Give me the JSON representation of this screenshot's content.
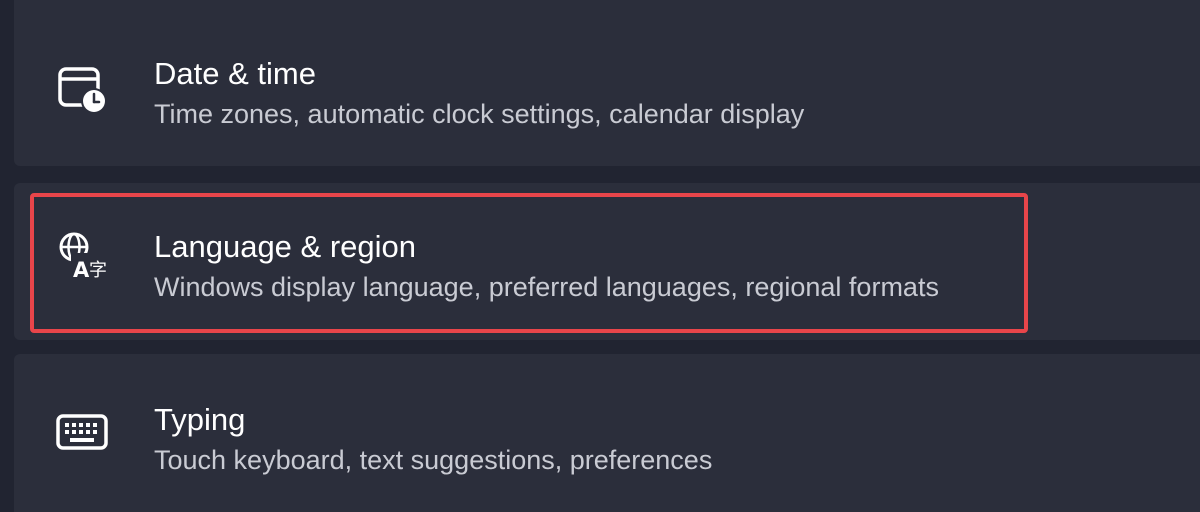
{
  "settings": {
    "items": [
      {
        "title": "Date & time",
        "description": "Time zones, automatic clock settings, calendar display",
        "icon": "calendar-clock-icon"
      },
      {
        "title": "Language & region",
        "description": "Windows display language, preferred languages, regional formats",
        "icon": "language-icon"
      },
      {
        "title": "Typing",
        "description": "Touch keyboard, text suggestions, preferences",
        "icon": "keyboard-icon"
      }
    ]
  },
  "colors": {
    "background": "#212431",
    "card": "#2b2e3b",
    "highlight": "#e8454a",
    "title": "#ffffff",
    "description": "#c9cbd3"
  }
}
